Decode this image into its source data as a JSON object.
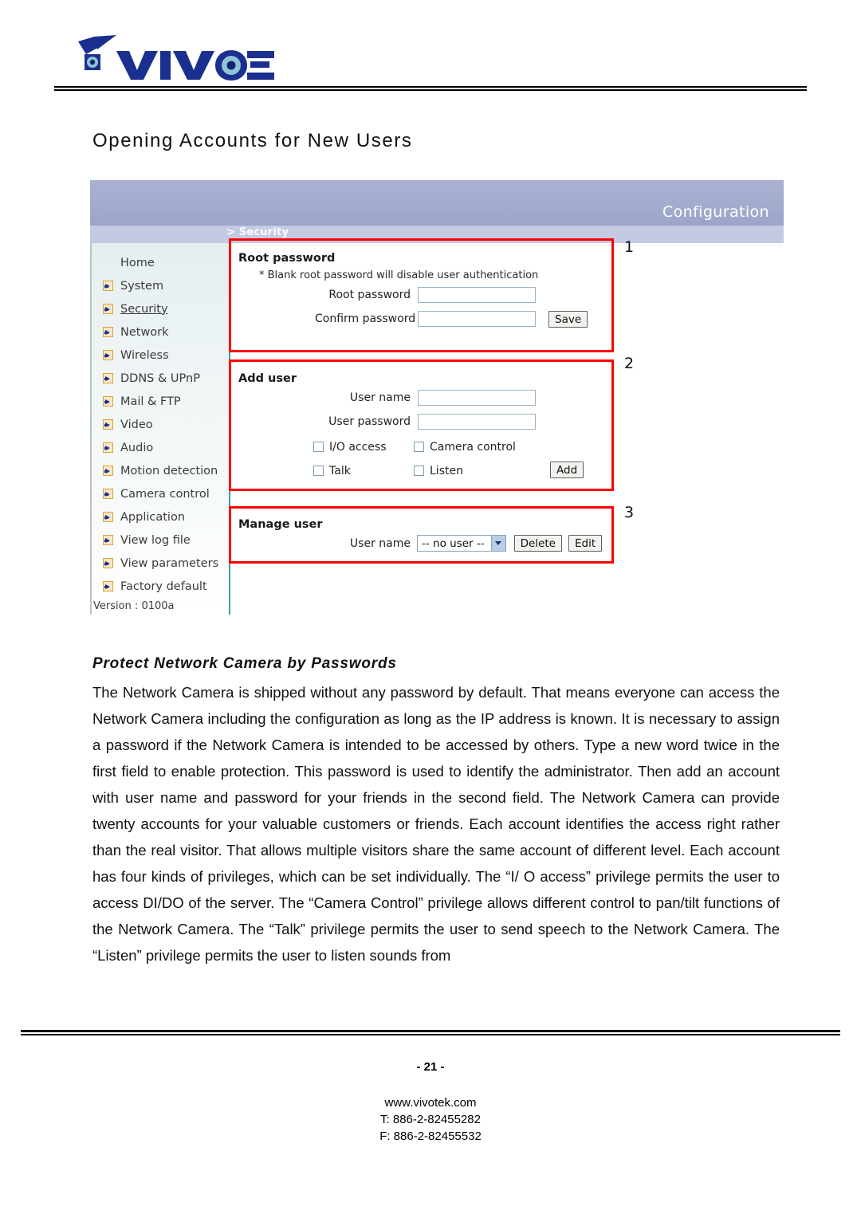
{
  "brand": {
    "name": "VIVOTEK"
  },
  "page_title": "Opening Accounts for New Users",
  "screenshot": {
    "header_title": "Configuration",
    "breadcrumb": "> Security",
    "sidebar": {
      "items": [
        {
          "label": "Home",
          "icon": "none",
          "active": false
        },
        {
          "label": "System",
          "icon": "arrow-icon",
          "active": false
        },
        {
          "label": "Security",
          "icon": "arrow-icon",
          "active": true
        },
        {
          "label": "Network",
          "icon": "arrow-icon",
          "active": false
        },
        {
          "label": "Wireless",
          "icon": "arrow-icon",
          "active": false
        },
        {
          "label": "DDNS & UPnP",
          "icon": "arrow-icon",
          "active": false
        },
        {
          "label": "Mail & FTP",
          "icon": "arrow-icon",
          "active": false
        },
        {
          "label": "Video",
          "icon": "arrow-icon",
          "active": false
        },
        {
          "label": "Audio",
          "icon": "arrow-icon",
          "active": false
        },
        {
          "label": "Motion detection",
          "icon": "arrow-icon",
          "active": false
        },
        {
          "label": "Camera control",
          "icon": "arrow-icon",
          "active": false
        },
        {
          "label": "Application",
          "icon": "arrow-icon",
          "active": false
        },
        {
          "label": "View log file",
          "icon": "arrow-icon",
          "active": false
        },
        {
          "label": "View parameters",
          "icon": "arrow-icon",
          "active": false
        },
        {
          "label": "Factory default",
          "icon": "arrow-icon",
          "active": false
        }
      ],
      "version": "Version : 0100a"
    },
    "root_password": {
      "title": "Root password",
      "note": "* Blank root password will disable user authentication",
      "root_label": "Root password",
      "root_value": "",
      "confirm_label": "Confirm password",
      "confirm_value": "",
      "save_label": "Save",
      "marker": "1"
    },
    "add_user": {
      "title": "Add user",
      "username_label": "User name",
      "username_value": "",
      "password_label": "User password",
      "password_value": "",
      "checkboxes": [
        {
          "label": "I/O access",
          "checked": false
        },
        {
          "label": "Camera control",
          "checked": false
        },
        {
          "label": "Talk",
          "checked": false
        },
        {
          "label": "Listen",
          "checked": false
        }
      ],
      "add_label": "Add",
      "marker": "2"
    },
    "manage_user": {
      "title": "Manage user",
      "username_label": "User name",
      "selected_user": "-- no user --",
      "options": [
        "-- no user --"
      ],
      "delete_label": "Delete",
      "edit_label": "Edit",
      "marker": "3"
    },
    "colors": {
      "header_blue": "#a3acd0",
      "subbar_blue": "#c4cae4",
      "annotation_red": "#ff0000",
      "divider_teal": "#3e9aa6",
      "icon_orange": "#d8a23c"
    }
  },
  "article": {
    "subhead": "Protect Network Camera by Passwords",
    "paragraph": "The Network Camera is shipped without any password by default. That means everyone can access the Network Camera including the configuration as long as the IP address is known. It is necessary to assign a password if the Network Camera is intended to be accessed by others. Type a new word twice in the first field to enable protection. This password is used to identify the administrator. Then add an account with user name and password for your friends in the second field. The Network Camera can provide twenty accounts for your valuable customers or friends. Each account identifies the access right rather than the real visitor. That allows multiple visitors share the same account of different level. Each account has four kinds of privileges, which can be set individually. The “I/ O access” privilege permits the user to access DI/DO of the server. The “Camera Control” privilege allows different control to pan/tilt functions of the Network Camera. The “Talk” privilege permits the user to send speech to the Network Camera. The “Listen” privilege permits the user to listen sounds from"
  },
  "footer": {
    "page_number": "- 21 -",
    "website": "www.vivotek.com",
    "tel": "T: 886-2-82455282",
    "fax": "F: 886-2-82455532"
  }
}
